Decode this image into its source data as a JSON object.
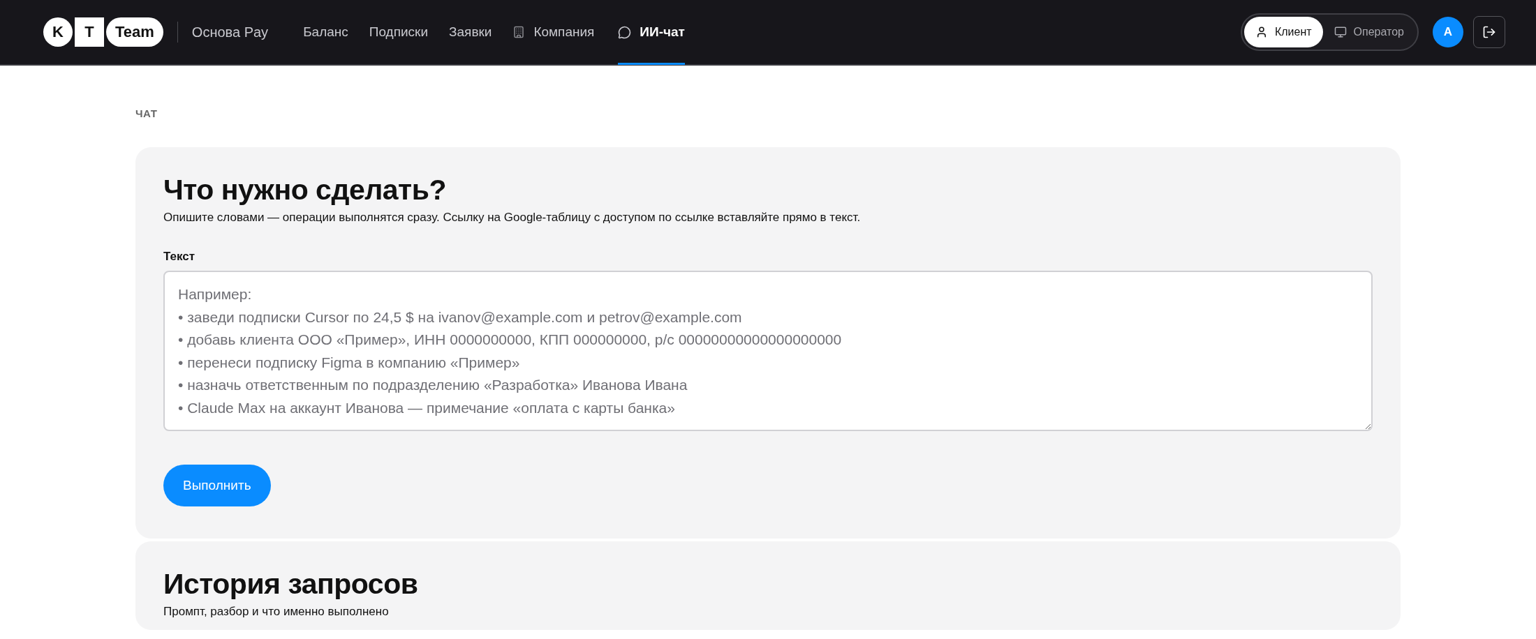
{
  "header": {
    "logo": {
      "letters": [
        "K",
        "T"
      ],
      "word": "Team"
    },
    "product": "Основа Pay",
    "nav": [
      {
        "label": "Баланс",
        "kind": "plain",
        "selected": false
      },
      {
        "label": "Подписки",
        "kind": "plain",
        "selected": false
      },
      {
        "label": "Заявки",
        "kind": "plain",
        "selected": false
      },
      {
        "label": "Компания",
        "kind": "building",
        "selected": false
      },
      {
        "label": "ИИ-чат",
        "kind": "chat",
        "selected": true
      }
    ],
    "roles": [
      {
        "label": "Клиент",
        "kind": "user",
        "selected": true
      },
      {
        "label": "Оператор",
        "kind": "monitor",
        "selected": false
      }
    ],
    "avatar": "A"
  },
  "breadcrumb": "ЧАТ",
  "task_card": {
    "title": "Что нужно сделать?",
    "subtitle": "Опишите словами — операции выполнятся сразу. Ссылку на Google-таблицу с доступом по ссылке вставляйте прямо в текст.",
    "field_label": "Текст",
    "placeholder": "Например:\n• заведи подписки Cursor по 24,5 $ на ivanov@example.com и petrov@example.com\n• добавь клиента ООО «Пример», ИНН 0000000000, КПП 000000000, р/с 00000000000000000000\n• перенеси подписку Figma в компанию «Пример»\n• назначь ответственным по подразделению «Разработка» Иванова Ивана\n• Claude Max на аккаунт Иванова — примечание «оплата с карты банка»",
    "button": "Выполнить"
  },
  "history_card": {
    "title": "История запросов",
    "subtitle": "Промпт, разбор и что именно выполнено"
  }
}
